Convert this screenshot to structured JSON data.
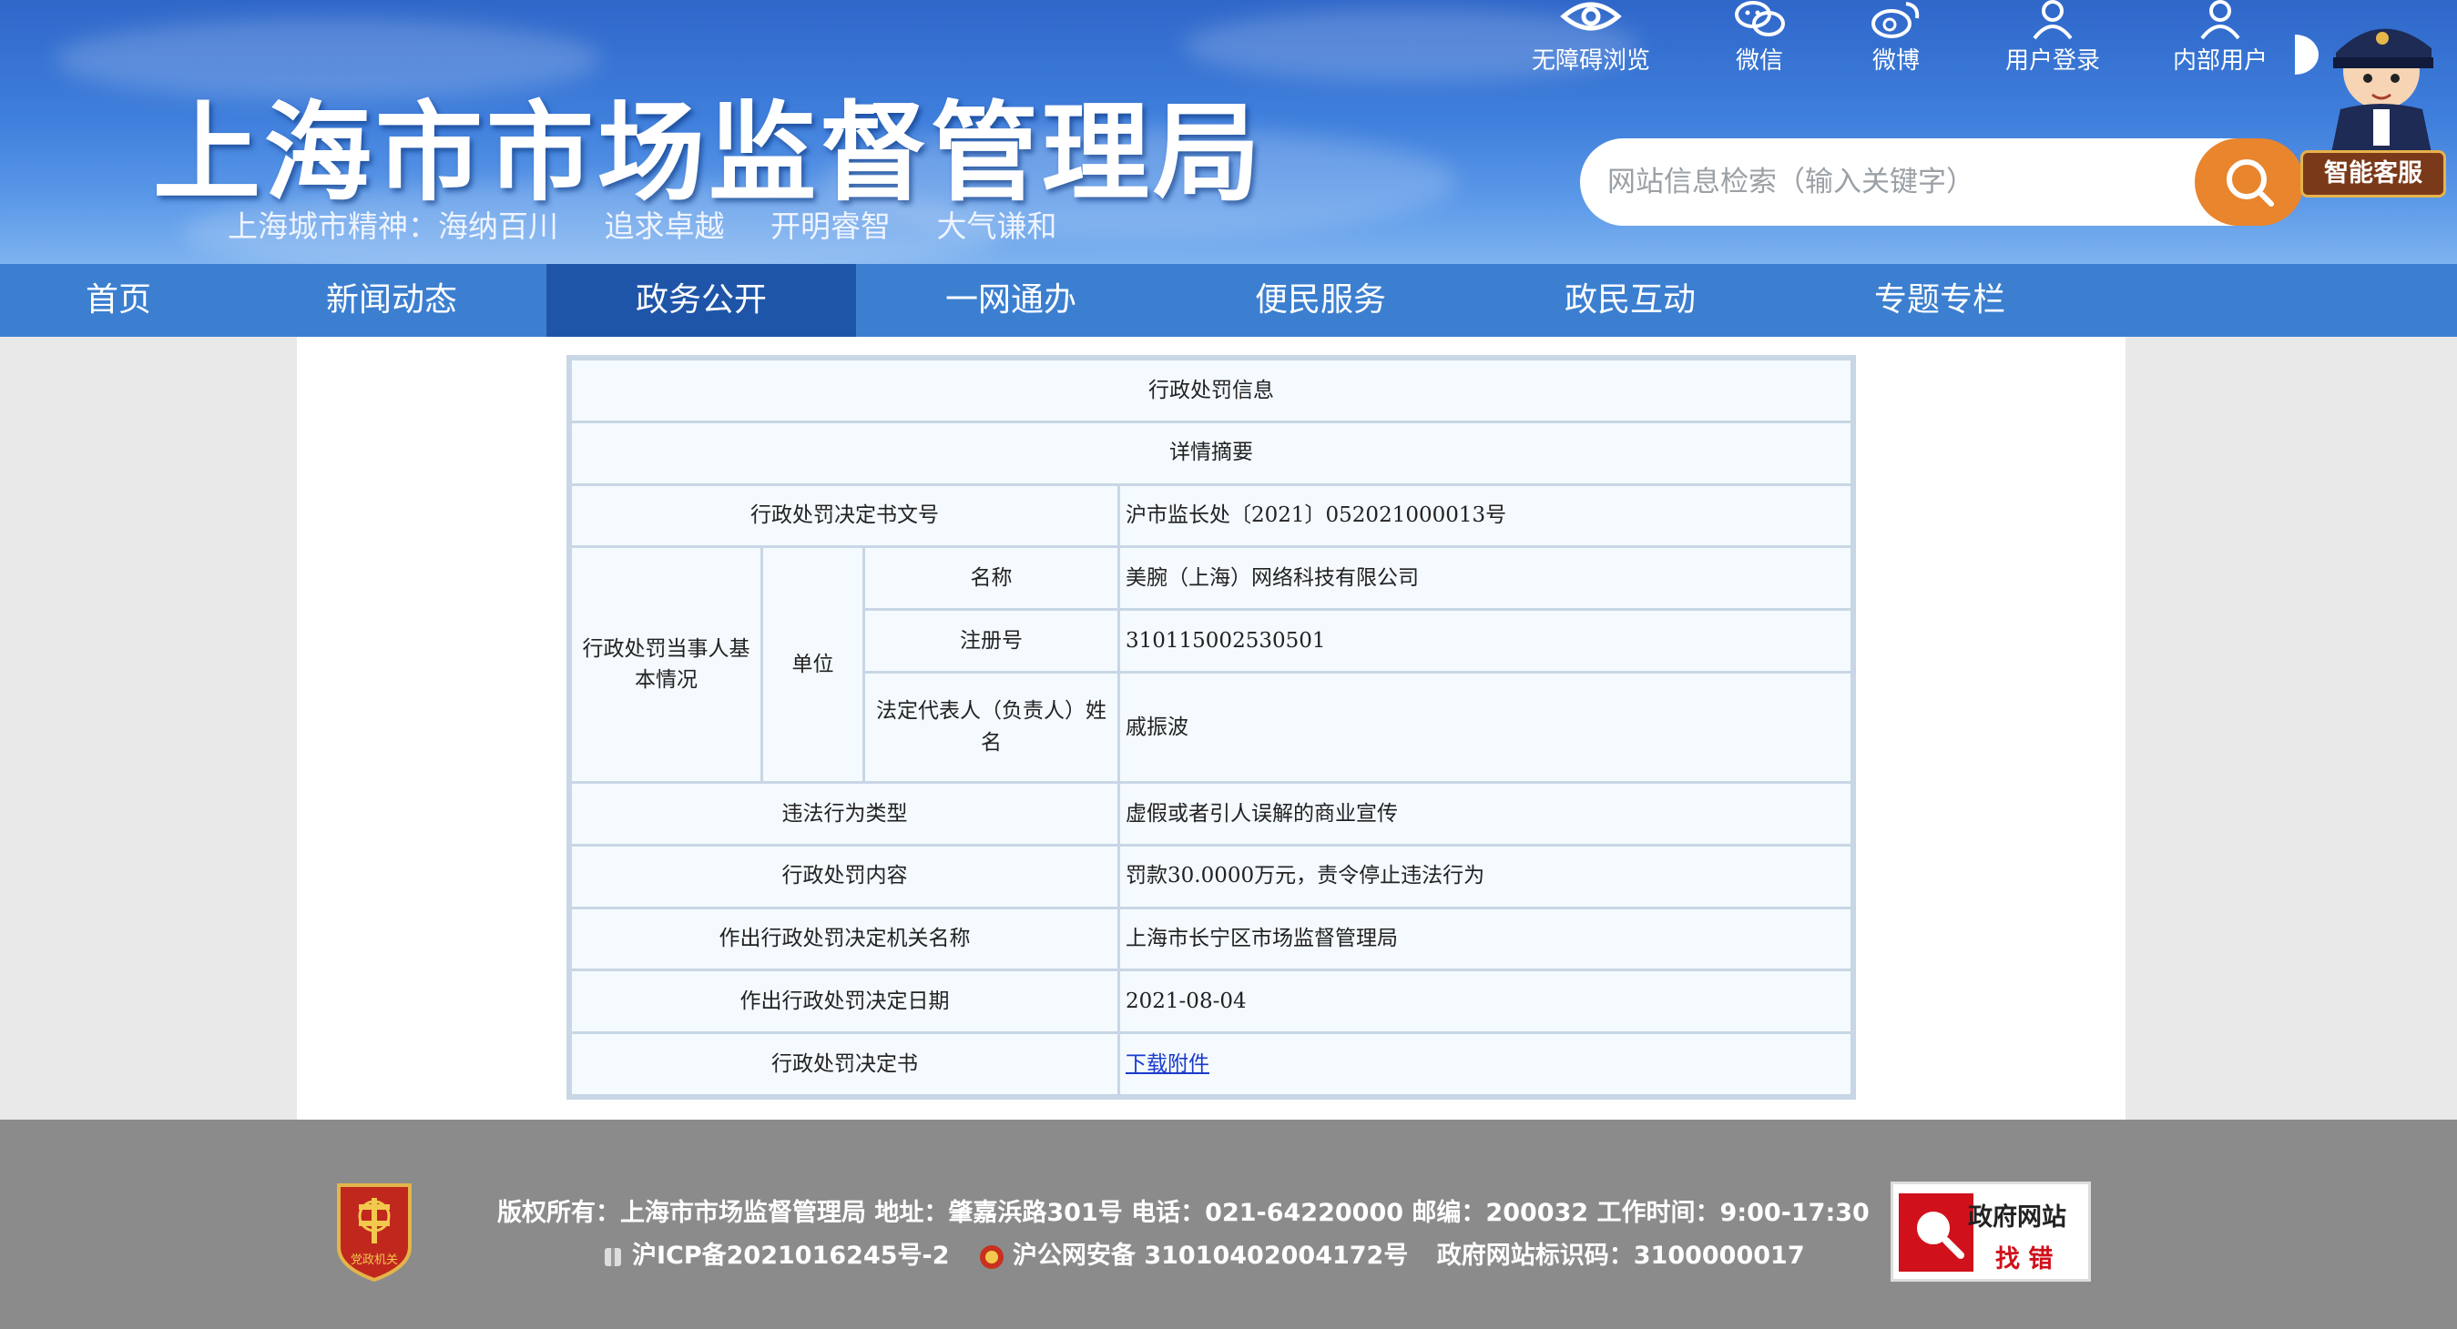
{
  "header": {
    "title": "上海市市场监督管理局",
    "spirit": [
      "上海城市精神：海纳百川",
      "追求卓越",
      "开明睿智",
      "大气谦和"
    ],
    "tools": [
      {
        "label": "无障碍浏览",
        "icon": "eye-icon"
      },
      {
        "label": "微信",
        "icon": "wechat-icon"
      },
      {
        "label": "微博",
        "icon": "weibo-icon"
      },
      {
        "label": "用户登录",
        "icon": "user-icon"
      },
      {
        "label": "内部用户",
        "icon": "user-icon"
      }
    ],
    "search_placeholder": "网站信息检索（输入关键字）",
    "service_label": "智能客服"
  },
  "nav": {
    "items": [
      "首页",
      "新闻动态",
      "政务公开",
      "一网通办",
      "便民服务",
      "政民互动",
      "专题专栏"
    ],
    "active": "政务公开"
  },
  "table": {
    "title": "行政处罚信息",
    "subtitle": "详情摘要",
    "doc_no_label": "行政处罚决定书文号",
    "doc_no": "沪市监长处〔2021〕052021000013号",
    "party_label": "行政处罚当事人基本情况",
    "unit_label": "单位",
    "name_label": "名称",
    "name": "美腕（上海）网络科技有限公司",
    "reg_label": "注册号",
    "reg_no": "310115002530501",
    "rep_label": "法定代表人（负责人）姓名",
    "rep": "戚振波",
    "violation_label": "违法行为类型",
    "violation": "虚假或者引人误解的商业宣传",
    "penalty_label": "行政处罚内容",
    "penalty": "罚款30.0000万元，责令停止违法行为",
    "authority_label": "作出行政处罚决定机关名称",
    "authority": "上海市长宁区市场监督管理局",
    "date_label": "作出行政处罚决定日期",
    "date": "2021-08-04",
    "decision_label": "行政处罚决定书",
    "decision_link": "下载附件"
  },
  "footer": {
    "line1": "版权所有：上海市市场监督管理局 地址：肇嘉浜路301号 电话：021-64220000 邮编：200032 工作时间：9:00-17:30",
    "icp": "沪ICP备2021016245号-2",
    "police": "沪公网安备 31010402004172号",
    "site_id": "政府网站标识码：3100000017",
    "badge_text": "党政机关",
    "zhaocuo_line1": "政府网站",
    "zhaocuo_line2": "找 错"
  },
  "colors": {
    "header_blue": "#3f7fdc",
    "nav_active": "#1f55a8",
    "search_button": "#e8852d",
    "link": "#1a3acc",
    "footer_bg": "#8b8b8b"
  }
}
